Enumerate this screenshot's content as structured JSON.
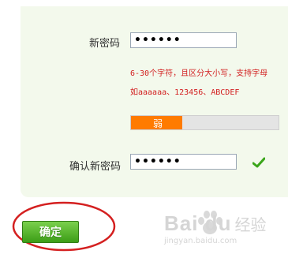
{
  "form": {
    "new_password_label": "新密码",
    "new_password_value": "••••••",
    "hint_line1": "6-30个字符，且区分大小写，支持字母",
    "hint_line2": "如aaaaaa、123456、ABCDEF",
    "strength": {
      "label": "弱",
      "level": 0.35,
      "color": "#ff7b00"
    },
    "confirm_password_label": "确认新密码",
    "confirm_password_value": "••••••",
    "confirm_status_icon": "checkmark-icon",
    "confirm_button_label": "确定"
  },
  "watermark": {
    "brand": "Bai  du",
    "brand_suffix": "经验",
    "url": "jingyan.baidu.com"
  },
  "colors": {
    "panel_bg": "#f3f9ec",
    "hint_text": "#d21f1f",
    "button": "#4fb324",
    "annotation_oval": "#d42020"
  }
}
